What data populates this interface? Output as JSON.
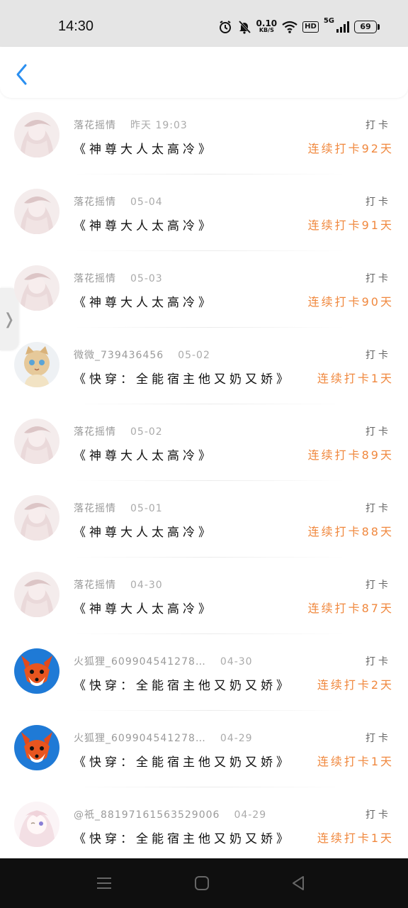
{
  "status_bar": {
    "time": "14:30",
    "net_speed_value": "0.10",
    "net_speed_unit": "KB/S",
    "hd": "HD",
    "network": "5G",
    "battery": "69",
    "icons": [
      "alarm-icon",
      "mute-icon",
      "wifi-icon",
      "signal-icon"
    ]
  },
  "header": {
    "back_icon": "chevron-left-icon"
  },
  "side_handle": {
    "glyph": "❭"
  },
  "rows": [
    {
      "user": "落花摇情",
      "date": "昨天 19:03",
      "book": "《神尊大人太高冷》",
      "action": "打卡",
      "streak": "连续打卡92天",
      "avatar": "lady"
    },
    {
      "user": "落花摇情",
      "date": "05-04",
      "book": "《神尊大人太高冷》",
      "action": "打卡",
      "streak": "连续打卡91天",
      "avatar": "lady"
    },
    {
      "user": "落花摇情",
      "date": "05-03",
      "book": "《神尊大人太高冷》",
      "action": "打卡",
      "streak": "连续打卡90天",
      "avatar": "lady"
    },
    {
      "user": "微微_739436456",
      "date": "05-02",
      "book": "《快穿：全能宿主他又奶又娇》",
      "action": "打卡",
      "streak": "连续打卡1天",
      "avatar": "cat"
    },
    {
      "user": "落花摇情",
      "date": "05-02",
      "book": "《神尊大人太高冷》",
      "action": "打卡",
      "streak": "连续打卡89天",
      "avatar": "lady"
    },
    {
      "user": "落花摇情",
      "date": "05-01",
      "book": "《神尊大人太高冷》",
      "action": "打卡",
      "streak": "连续打卡88天",
      "avatar": "lady"
    },
    {
      "user": "落花摇情",
      "date": "04-30",
      "book": "《神尊大人太高冷》",
      "action": "打卡",
      "streak": "连续打卡87天",
      "avatar": "lady"
    },
    {
      "user": "火狐狸_609904541278…",
      "date": "04-30",
      "book": "《快穿：全能宿主他又奶又娇》",
      "action": "打卡",
      "streak": "连续打卡2天",
      "avatar": "fox"
    },
    {
      "user": "火狐狸_609904541278…",
      "date": "04-29",
      "book": "《快穿：全能宿主他又奶又娇》",
      "action": "打卡",
      "streak": "连续打卡1天",
      "avatar": "fox"
    },
    {
      "user": "@祇_88197161563529006",
      "date": "04-29",
      "book": "《快穿：全能宿主他又奶又娇》",
      "action": "打卡",
      "streak": "连续打卡1天",
      "avatar": "girl"
    }
  ],
  "nav": {
    "icons": [
      "menu-icon",
      "home-icon",
      "back-triangle-icon"
    ]
  },
  "colors": {
    "accent": "#f0883e",
    "back": "#2b8ff0"
  }
}
